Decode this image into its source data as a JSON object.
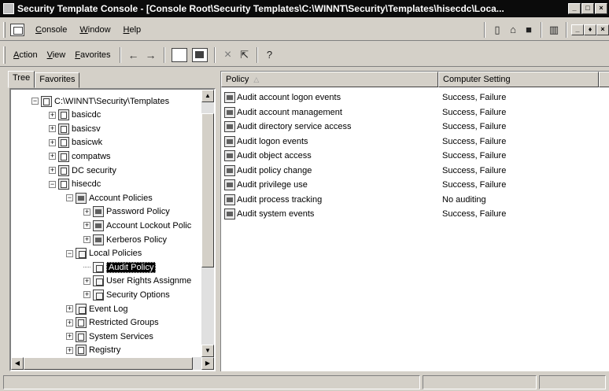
{
  "window": {
    "title": "Security Template Console - [Console Root\\Security Templates\\C:\\WINNT\\Security\\Templates\\hisecdc\\Loca...",
    "buttons": [
      "_",
      "□",
      "×"
    ]
  },
  "menubar": {
    "items": [
      {
        "label": "Console",
        "accel": "C"
      },
      {
        "label": "Window",
        "accel": "W"
      },
      {
        "label": "Help",
        "accel": "H"
      }
    ],
    "child_buttons": [
      "_",
      "♦",
      "×"
    ]
  },
  "toolbar": {
    "menus": [
      {
        "label": "Action",
        "accel": "A"
      },
      {
        "label": "View",
        "accel": "V"
      },
      {
        "label": "Favorites",
        "accel": "F"
      }
    ],
    "back_icon": "←",
    "forward_icon": "→",
    "delete_icon": "×",
    "export_icon": "⇱",
    "help_icon": "?"
  },
  "tree_tabs": [
    "Tree",
    "Favorites"
  ],
  "tree": [
    {
      "label": "C:\\WINNT\\Security\\Templates",
      "expander": "−",
      "icon": "doc",
      "depth": 0
    },
    {
      "label": "basicdc",
      "expander": "+",
      "icon": "doc",
      "depth": 1
    },
    {
      "label": "basicsv",
      "expander": "+",
      "icon": "doc",
      "depth": 1
    },
    {
      "label": "basicwk",
      "expander": "+",
      "icon": "doc",
      "depth": 1
    },
    {
      "label": "compatws",
      "expander": "+",
      "icon": "doc",
      "depth": 1
    },
    {
      "label": "DC security",
      "expander": "+",
      "icon": "doc",
      "depth": 1
    },
    {
      "label": "hisecdc",
      "expander": "−",
      "icon": "doc",
      "depth": 1
    },
    {
      "label": "Account Policies",
      "expander": "−",
      "icon": "policy",
      "depth": 2
    },
    {
      "label": "Password Policy",
      "expander": "+",
      "icon": "policy",
      "depth": 3
    },
    {
      "label": "Account Lockout Polic",
      "expander": "+",
      "icon": "policy",
      "depth": 3
    },
    {
      "label": "Kerberos Policy",
      "expander": "+",
      "icon": "policy",
      "depth": 3
    },
    {
      "label": "Local Policies",
      "expander": "−",
      "icon": "folder",
      "depth": 2
    },
    {
      "label": "Audit Policy",
      "expander": "",
      "icon": "folder",
      "depth": 3,
      "selected": true
    },
    {
      "label": "User Rights Assignme",
      "expander": "+",
      "icon": "folder",
      "depth": 3
    },
    {
      "label": "Security Options",
      "expander": "+",
      "icon": "folder",
      "depth": 3
    },
    {
      "label": "Event Log",
      "expander": "+",
      "icon": "folder",
      "depth": 2
    },
    {
      "label": "Restricted Groups",
      "expander": "+",
      "icon": "doc",
      "depth": 2
    },
    {
      "label": "System Services",
      "expander": "+",
      "icon": "doc",
      "depth": 2
    },
    {
      "label": "Registry",
      "expander": "+",
      "icon": "doc",
      "depth": 2
    }
  ],
  "list": {
    "columns": [
      "Policy",
      "Computer Setting"
    ],
    "sort_indicator": "△",
    "rows": [
      {
        "policy": "Audit account logon events",
        "setting": "Success, Failure"
      },
      {
        "policy": "Audit account management",
        "setting": "Success, Failure"
      },
      {
        "policy": "Audit directory service access",
        "setting": "Success, Failure"
      },
      {
        "policy": "Audit logon events",
        "setting": "Success, Failure"
      },
      {
        "policy": "Audit object access",
        "setting": "Success, Failure"
      },
      {
        "policy": "Audit policy change",
        "setting": "Success, Failure"
      },
      {
        "policy": "Audit privilege use",
        "setting": "Success, Failure"
      },
      {
        "policy": "Audit process tracking",
        "setting": "No auditing"
      },
      {
        "policy": "Audit system events",
        "setting": "Success, Failure"
      }
    ]
  }
}
